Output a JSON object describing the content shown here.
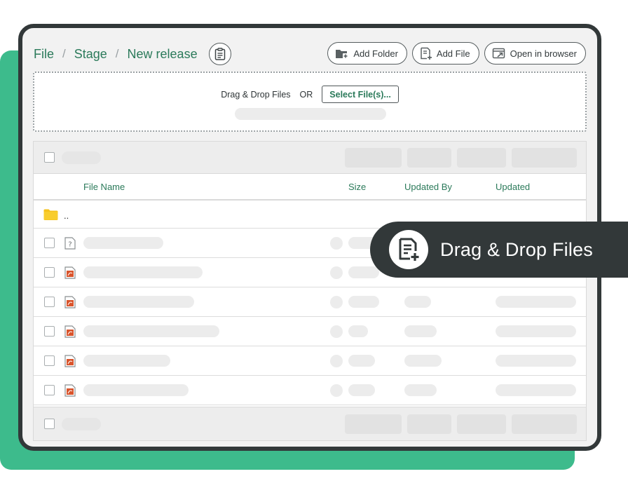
{
  "breadcrumb": {
    "items": [
      "File",
      "Stage",
      "New release"
    ],
    "separator": "/"
  },
  "toolbar": {
    "add_folder": "Add Folder",
    "add_file": "Add File",
    "open_browser": "Open in browser"
  },
  "dropzone": {
    "label": "Drag & Drop Files",
    "or": "OR",
    "select_label": "Select File(s)..."
  },
  "table": {
    "columns": {
      "name": "File Name",
      "size": "Size",
      "updated_by": "Updated By",
      "updated": "Updated"
    },
    "parent_row_label": ".."
  },
  "overlay": {
    "label": "Drag & Drop Files"
  },
  "icons": {
    "clipboard": "clipboard-icon",
    "add_folder": "folder-plus-icon",
    "add_file": "file-plus-icon",
    "open_browser": "browser-open-icon",
    "folder": "folder-icon",
    "unknown_file": "unknown-file-icon",
    "pdf_file": "pdf-file-icon"
  },
  "colors": {
    "accent": "#2b7a5a",
    "backdrop": "#3dbb8c",
    "frame": "#323839",
    "folder": "#f5c21b",
    "pdf": "#d9542c"
  }
}
